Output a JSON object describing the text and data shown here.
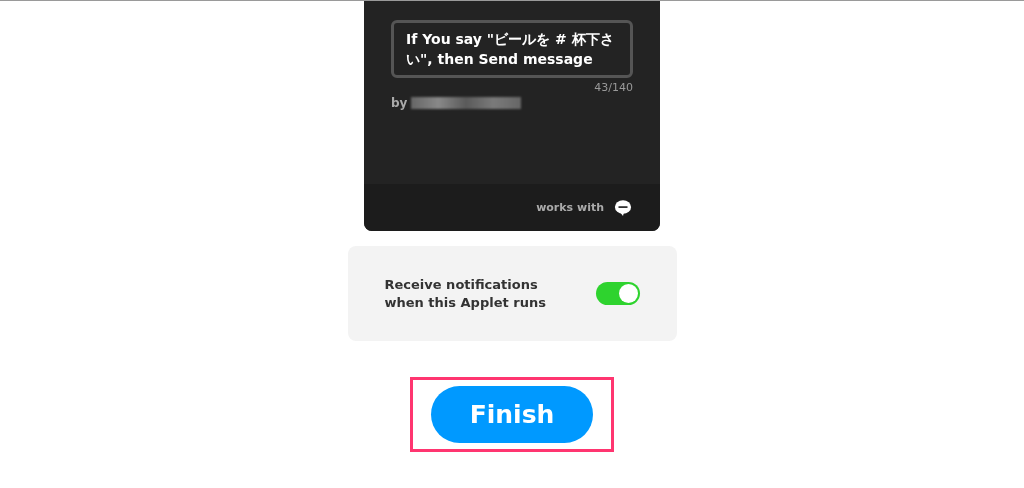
{
  "applet_card": {
    "title": "If You say \"ビールを # 杯下さい\", then Send message",
    "char_count": "43/140",
    "author_prefix": "by",
    "works_with": "works with"
  },
  "notification_setting": {
    "label": "Receive notifications when this Applet runs",
    "on": true
  },
  "finish_button": {
    "label": "Finish",
    "highlighted": true
  }
}
